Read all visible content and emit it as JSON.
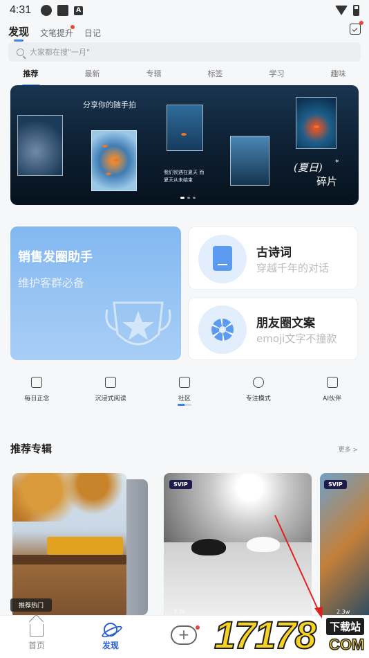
{
  "status_bar": {
    "time": "4:31"
  },
  "top_nav": {
    "tabs": [
      {
        "label": "发现",
        "active": true
      },
      {
        "label": "文笔提升",
        "active": false
      },
      {
        "label": "日记",
        "active": false
      }
    ]
  },
  "search": {
    "placeholder": "大家都在搜\"一月\""
  },
  "categories": [
    "推荐",
    "最新",
    "专辑",
    "标签",
    "学习",
    "趣味"
  ],
  "banner": {
    "caption": "分享你的随手拍",
    "small_text": "我们彻遇在夏天 而夏天从未结束",
    "title_line1": "(夏日)",
    "title_line2": "碎片",
    "star": "*"
  },
  "feature_cards": {
    "big": {
      "title": "销售发圈助手",
      "subtitle": "维护客群必备"
    },
    "poetry": {
      "title": "古诗词",
      "subtitle": "穿越千年的对话"
    },
    "moments": {
      "title": "朋友圈文案",
      "subtitle": "emoji文字不撞款"
    }
  },
  "tools": [
    "每日正念",
    "沉浸式阅读",
    "社区",
    "专注模式",
    "AI伙伴"
  ],
  "recommended": {
    "title": "推荐专辑",
    "more": "更多 >",
    "albums": [
      {
        "tag": "推荐热门"
      },
      {
        "badge": "SVIP",
        "views": "7.7k"
      },
      {
        "badge": "SVIP",
        "views": "2.3w"
      }
    ]
  },
  "bottom_nav": {
    "home": "首页",
    "discover": "发现"
  },
  "watermark": {
    "number": "17178",
    "label": "下载站",
    "domain": "COM"
  },
  "colors": {
    "accent": "#3b7ef0",
    "active_nav": "#2a61d6",
    "badge_red": "#e8483a"
  }
}
